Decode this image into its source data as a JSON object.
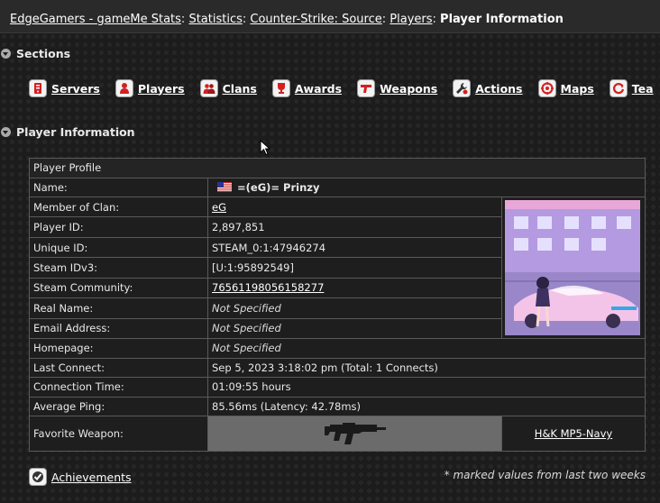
{
  "breadcrumb": {
    "items": [
      "EdgeGamers - gameMe Stats",
      "Statistics",
      "Counter-Strike: Source",
      "Players"
    ],
    "separator": ":",
    "current": "Player Information"
  },
  "sections_heading": "Sections",
  "nav": [
    {
      "label": "Servers",
      "icon": "server-icon"
    },
    {
      "label": "Players",
      "icon": "player-icon"
    },
    {
      "label": "Clans",
      "icon": "clan-icon"
    },
    {
      "label": "Awards",
      "icon": "trophy-icon"
    },
    {
      "label": "Weapons",
      "icon": "weapon-icon"
    },
    {
      "label": "Actions",
      "icon": "wrench-icon"
    },
    {
      "label": "Maps",
      "icon": "map-target-icon"
    },
    {
      "label": "Tea",
      "icon": "team-icon"
    }
  ],
  "player_info_heading": "Player Information",
  "profile": {
    "header": "Player Profile",
    "name_label": "Name:",
    "name_value": "=(eG)= Prinzy",
    "clan_label": "Member of Clan:",
    "clan_value": "eG",
    "player_id_label": "Player ID:",
    "player_id_value": "2,897,851",
    "unique_id_label": "Unique ID:",
    "unique_id_value": "STEAM_0:1:47946274",
    "steam_idv3_label": "Steam IDv3:",
    "steam_idv3_value": "[U:1:95892549]",
    "steam_community_label": "Steam Community:",
    "steam_community_value": "76561198056158277",
    "real_name_label": "Real Name:",
    "real_name_value": "Not Specified",
    "email_label": "Email Address:",
    "email_value": "Not Specified",
    "homepage_label": "Homepage:",
    "homepage_value": "Not Specified",
    "last_connect_label": "Last Connect:",
    "last_connect_value": "Sep 5, 2023 3:18:02 pm (Total: 1 Connects)",
    "connection_time_label": "Connection Time:",
    "connection_time_value": "01:09:55 hours",
    "avg_ping_label": "Average Ping:",
    "avg_ping_value": "85.56ms (Latency: 42.78ms)",
    "fav_weapon_label": "Favorite Weapon:",
    "fav_weapon_value": "H&K MP5-Navy"
  },
  "achievements_label": "Achievements",
  "footnote": "* marked values from last two weeks",
  "colors": {
    "background": "#1c1c1c",
    "table_border": "#5a5a5a",
    "weapon_bg": "#6b6b6b"
  }
}
